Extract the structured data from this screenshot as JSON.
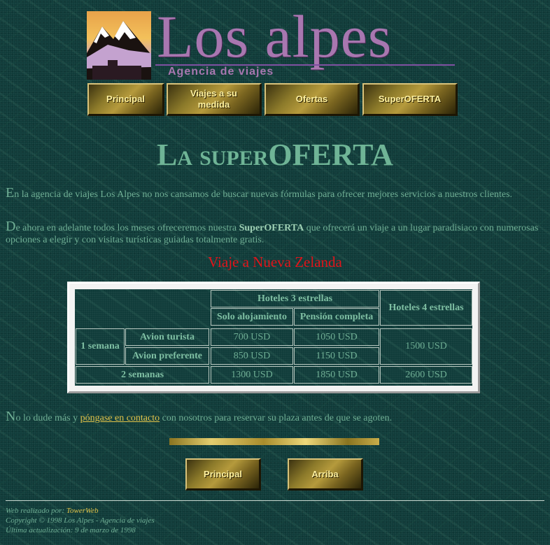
{
  "header": {
    "title": "Los alpes",
    "subtitle": "Agencia de viajes",
    "logo_icon": "mountain-logo-icon"
  },
  "nav": [
    {
      "label": "Principal"
    },
    {
      "label": "Viajes a su medida"
    },
    {
      "label": "Ofertas"
    },
    {
      "label": "SuperOFERTA"
    }
  ],
  "page_title": {
    "l": "L",
    "a": "A",
    "super": "SUPER",
    "oferta": "OFERTA"
  },
  "intro": {
    "p1_cap": "E",
    "p1_rest": "n la agencia de viajes Los Alpes no nos cansamos de buscar nuevas fórmulas para ofrecer mejores servicios a nuestros clientes.",
    "p2_cap": "D",
    "p2_pre": "e ahora en adelante todos los meses ofreceremos nuestra ",
    "p2_bold": "SuperOFERTA",
    "p2_post": " que ofrecerá un viaje a un lugar paradisiaco con numerosas opciones a elegir y con visitas turísticas guiadas totalmente gratis."
  },
  "highlight": "Viaje a Nueva Zelanda",
  "table": {
    "h3": "Hoteles 3 estrellas",
    "h4": "Hoteles 4 estrellas",
    "solo": "Solo alojamiento",
    "pension": "Pensión completa",
    "week1": "1 semana",
    "turista": "Avion turista",
    "preferente": "Avion preferente",
    "week2": "2 semanas",
    "r1_solo": "700 USD",
    "r1_pension": "1050 USD",
    "r1_h4": "1500 USD",
    "r2_solo": "850 USD",
    "r2_pension": "1150 USD",
    "r3_solo": "1300 USD",
    "r3_pension": "1850 USD",
    "r3_h4": "2600 USD"
  },
  "bottom": {
    "cap": "N",
    "pre": "o lo dude más y ",
    "link": "póngase en contacto",
    "post": " con nosotros para reservar su plaza antes de que se agoten."
  },
  "bottom_nav": [
    {
      "label": "Principal"
    },
    {
      "label": "Arriba"
    }
  ],
  "footer": {
    "made_by": "Web realizado por:",
    "made_by_link": "TowerWeb",
    "copyright": "Copyright © 1998 Los Alpes - Agencia de viajes",
    "updated": "Última actualización: 9 de marzo de 1998"
  }
}
